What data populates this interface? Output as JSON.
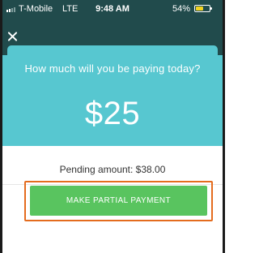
{
  "status_bar": {
    "carrier": "T-Mobile",
    "network": "LTE",
    "time": "9:48 AM",
    "battery_percent": "54%",
    "battery_level": 0.54
  },
  "header": {
    "close_icon": "close-icon"
  },
  "payment": {
    "question": "How much will you be paying today?",
    "amount": "$25",
    "pending_label": "Pending amount: $38.00",
    "button_label": "MAKE PARTIAL PAYMENT"
  },
  "colors": {
    "header": "#214b4c",
    "accent": "#57c7d0",
    "button": "#59c45f",
    "highlight": "#e46c1e",
    "battery": "#f2d223"
  }
}
